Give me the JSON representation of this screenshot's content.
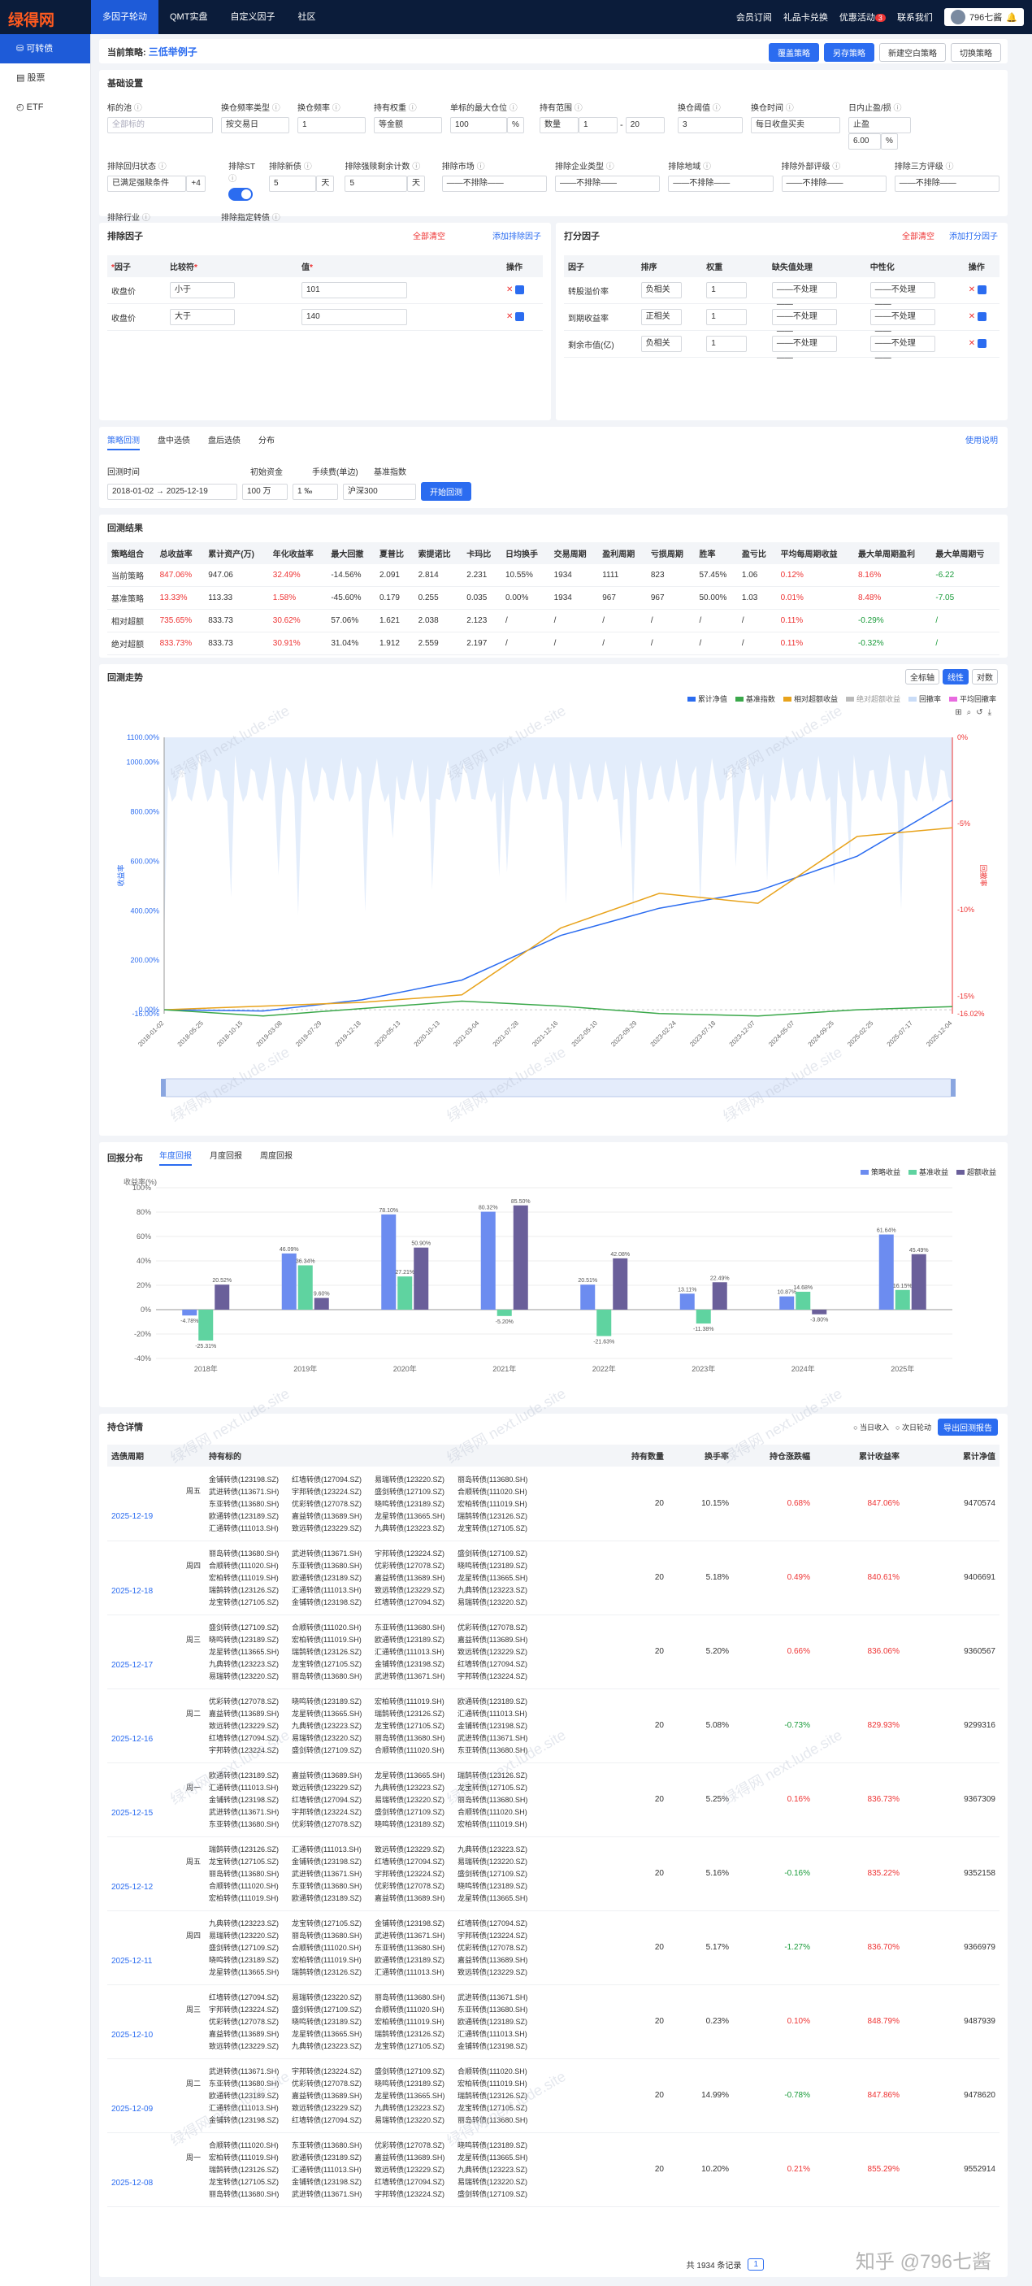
{
  "app": {
    "logo": "绿得网",
    "nav": [
      "多因子轮动",
      "QMT实盘",
      "自定义因子",
      "社区"
    ],
    "right": [
      "会员订阅",
      "礼品卡兑换",
      "优惠活动",
      "联系我们"
    ],
    "badge_count": "3",
    "user": "796七酱"
  },
  "sidebar": [
    "可转债",
    "股票",
    "ETF"
  ],
  "strategy": {
    "label": "当前策略:",
    "name": "三低举例子",
    "buttons": [
      "覆盖策略",
      "另存策略",
      "新建空白策略",
      "切换策略"
    ]
  },
  "basic": {
    "title": "基础设置",
    "row1": [
      {
        "label": "标的池",
        "value": "全部标的",
        "ph": true
      },
      {
        "label": "换仓频率类型",
        "value": "按交易日"
      },
      {
        "label": "换仓频率",
        "value": "1"
      },
      {
        "label": "持有权重",
        "value": "等金额"
      },
      {
        "label": "单标的最大仓位",
        "value": "100",
        "unit": "%"
      },
      {
        "label": "持有范围",
        "value": "数量",
        "from": "1",
        "to": "20"
      },
      {
        "label": "换仓阈值",
        "value": "3"
      },
      {
        "label": "换仓时间",
        "value": "每日收盘买卖"
      },
      {
        "label": "日内止盈/损",
        "value": "止盈",
        "pct": "6.00",
        "unit": "%"
      }
    ],
    "row2": [
      {
        "label": "排除回归状态",
        "value": "已满足强赎条件",
        "extra": "+4"
      },
      {
        "label": "排除ST"
      },
      {
        "label": "排除新债",
        "value": "5",
        "unit": "天"
      },
      {
        "label": "排除强赎剩余计数",
        "value": "5",
        "unit": "天"
      },
      {
        "label": "排除市场",
        "value": "——不排除——"
      },
      {
        "label": "排除企业类型",
        "value": "——不排除——"
      },
      {
        "label": "排除地域",
        "value": "——不排除——"
      },
      {
        "label": "排除外部评级",
        "value": "——不排除——"
      },
      {
        "label": "排除三方评级",
        "value": "——不排除——"
      }
    ],
    "row3": [
      {
        "label": "排除行业",
        "value": "——不排除——"
      },
      {
        "label": "排除指定转债",
        "value": "——不排除——"
      }
    ]
  },
  "exclude": {
    "title": "排除因子",
    "clear": "全部清空",
    "add": "添加排除因子",
    "cols": [
      "因子",
      "比较符",
      "值",
      "操作"
    ],
    "rows": [
      {
        "factor": "收盘价",
        "op": "小于",
        "val": "101"
      },
      {
        "factor": "收盘价",
        "op": "大于",
        "val": "140"
      }
    ]
  },
  "score": {
    "title": "打分因子",
    "clear": "全部清空",
    "add": "添加打分因子",
    "cols": [
      "因子",
      "排序",
      "权重",
      "缺失值处理",
      "中性化",
      "操作"
    ],
    "rows": [
      {
        "factor": "转股溢价率",
        "sort": "负相关",
        "w": "1"
      },
      {
        "factor": "到期收益率",
        "sort": "正相关",
        "w": "1"
      },
      {
        "factor": "剩余市值(亿)",
        "sort": "负相关",
        "w": "1"
      }
    ],
    "nohandle": "——不处理——"
  },
  "backtest": {
    "tabs": [
      "策略回测",
      "盘中选债",
      "盘后选债",
      "分布"
    ],
    "help": "使用说明",
    "labels": [
      "回测时间",
      "初始资金",
      "手续费(单边)",
      "基准指数"
    ],
    "start": "2018-01-02",
    "end": "2025-12-19",
    "capital": "100",
    "capital_unit": "万",
    "fee": "1",
    "fee_unit": "‰",
    "index": "沪深300",
    "run": "开始回测"
  },
  "results": {
    "title": "回测结果",
    "cols": [
      "策略组合",
      "总收益率",
      "累计资产(万)",
      "年化收益率",
      "最大回撤",
      "夏普比",
      "索提诺比",
      "卡玛比",
      "日均换手",
      "交易周期",
      "盈利周期",
      "亏损周期",
      "胜率",
      "盈亏比",
      "平均每周期收益",
      "最大单周期盈利",
      "最大单周期亏"
    ],
    "rows": [
      [
        "当前策略",
        "847.06%",
        "947.06",
        "32.49%",
        "-14.56%",
        "2.091",
        "2.814",
        "2.231",
        "10.55%",
        "1934",
        "1111",
        "823",
        "57.45%",
        "1.06",
        "0.12%",
        "8.16%",
        "-6.22"
      ],
      [
        "基准策略",
        "13.33%",
        "113.33",
        "1.58%",
        "-45.60%",
        "0.179",
        "0.255",
        "0.035",
        "0.00%",
        "1934",
        "967",
        "967",
        "50.00%",
        "1.03",
        "0.01%",
        "8.48%",
        "-7.05"
      ],
      [
        "相对超额",
        "735.65%",
        "833.73",
        "30.62%",
        "57.06%",
        "1.621",
        "2.038",
        "2.123",
        "/",
        "/",
        "/",
        "/",
        "/",
        "/",
        "0.11%",
        "-0.29%",
        "/"
      ],
      [
        "绝对超额",
        "833.73%",
        "833.73",
        "30.91%",
        "31.04%",
        "1.912",
        "2.559",
        "2.197",
        "/",
        "/",
        "/",
        "/",
        "/",
        "/",
        "0.11%",
        "-0.32%",
        "/"
      ]
    ]
  },
  "trend": {
    "title": "回测走势",
    "toggles": [
      "全标轴",
      "线性",
      "对数"
    ],
    "legend": [
      "累计净值",
      "基准指数",
      "相对超额收益",
      "绝对超额收益",
      "回撤率",
      "平均回撤率"
    ],
    "ylabel_left": "收益率",
    "ylabel_right": "回撤率",
    "yticks_left": [
      "1100.00%",
      "1000.00%",
      "800.00%",
      "600.00%",
      "400.00%",
      "200.00%",
      "0.00%",
      "-16.00%"
    ],
    "yticks_right": [
      "0%",
      "-5%",
      "-10%",
      "-15%",
      "-16.02%"
    ],
    "xticks": [
      "2018-01-02",
      "2018-05-25",
      "2018-10-15",
      "2019-03-08",
      "2019-07-29",
      "2019-12-18",
      "2020-05-13",
      "2020-10-13",
      "2021-03-04",
      "2021-07-28",
      "2021-12-16",
      "2022-05-10",
      "2022-09-29",
      "2023-02-24",
      "2023-07-18",
      "2023-12-07",
      "2024-05-07",
      "2024-09-25",
      "2025-02-25",
      "2025-07-17",
      "2025-12-04"
    ]
  },
  "chart_data": [
    {
      "type": "line",
      "title": "回测走势",
      "x": [
        "2018-01-02",
        "2019-01-02",
        "2020-01-02",
        "2021-01-04",
        "2022-01-04",
        "2023-01-03",
        "2024-01-02",
        "2025-01-02",
        "2025-12-19"
      ],
      "series": [
        {
          "name": "累计净值",
          "values": [
            0,
            -5,
            40,
            120,
            300,
            410,
            480,
            620,
            847
          ]
        },
        {
          "name": "相对超额收益",
          "values": [
            0,
            15,
            30,
            60,
            330,
            470,
            430,
            700,
            735
          ]
        },
        {
          "name": "基准指数",
          "values": [
            0,
            -25,
            5,
            35,
            15,
            -15,
            -25,
            0,
            13
          ]
        }
      ],
      "ylabel": "收益率",
      "ylim": [
        -16,
        1100
      ]
    },
    {
      "type": "bar",
      "title": "回报分布",
      "categories": [
        "2018年",
        "2019年",
        "2020年",
        "2021年",
        "2022年",
        "2023年",
        "2024年",
        "2025年"
      ],
      "series": [
        {
          "name": "策略收益",
          "values": [
            -4.78,
            46.09,
            78.1,
            80.32,
            20.51,
            13.11,
            10.87,
            61.64
          ]
        },
        {
          "name": "基准收益",
          "values": [
            -25.31,
            36.34,
            27.21,
            -5.2,
            -21.63,
            -11.38,
            14.68,
            16.15
          ]
        },
        {
          "name": "超额收益",
          "values": [
            20.52,
            9.6,
            50.9,
            85.5,
            42.08,
            22.49,
            -3.8,
            45.49
          ]
        }
      ],
      "ylabel": "收益率(%)",
      "ylim": [
        -40,
        100
      ],
      "yticks": [
        "100%",
        "80%",
        "60%",
        "40%",
        "20%",
        "0%",
        "-20%",
        "-40%"
      ]
    }
  ],
  "dist": {
    "title": "回报分布",
    "tabs": [
      "年度回报",
      "月度回报",
      "周度回报"
    ]
  },
  "holdings": {
    "title": "持仓详情",
    "options": [
      "当日收入",
      "次日轮动"
    ],
    "export": "导出回测报告",
    "cols": [
      "选债周期",
      "持有标的",
      "持有数量",
      "换手率",
      "持仓涨跌幅",
      "累计收益率",
      "累计净值"
    ],
    "rows": [
      {
        "date": "2025-12-19",
        "wd": "周五",
        "n": "20",
        "turn": "10.15%",
        "chg": "0.68%",
        "cum": "847.06%",
        "nav": "9470574"
      },
      {
        "date": "2025-12-18",
        "wd": "周四",
        "n": "20",
        "turn": "5.18%",
        "chg": "0.49%",
        "cum": "840.61%",
        "nav": "9406691"
      },
      {
        "date": "2025-12-17",
        "wd": "周三",
        "n": "20",
        "turn": "5.20%",
        "chg": "0.66%",
        "cum": "836.06%",
        "nav": "9360567"
      },
      {
        "date": "2025-12-16",
        "wd": "周二",
        "n": "20",
        "turn": "5.08%",
        "chg": "-0.73%",
        "cum": "829.93%",
        "nav": "9299316"
      },
      {
        "date": "2025-12-15",
        "wd": "周一",
        "n": "20",
        "turn": "5.25%",
        "chg": "0.16%",
        "cum": "836.73%",
        "nav": "9367309"
      },
      {
        "date": "2025-12-12",
        "wd": "周五",
        "n": "20",
        "turn": "5.16%",
        "chg": "-0.16%",
        "cum": "835.22%",
        "nav": "9352158"
      },
      {
        "date": "2025-12-11",
        "wd": "周四",
        "n": "20",
        "turn": "5.17%",
        "chg": "-1.27%",
        "cum": "836.70%",
        "nav": "9366979"
      },
      {
        "date": "2025-12-10",
        "wd": "周三",
        "n": "20",
        "turn": "0.23%",
        "chg": "0.10%",
        "cum": "848.79%",
        "nav": "9487939"
      },
      {
        "date": "2025-12-09",
        "wd": "周二",
        "n": "20",
        "turn": "14.99%",
        "chg": "-0.78%",
        "cum": "847.86%",
        "nav": "9478620"
      },
      {
        "date": "2025-12-08",
        "wd": "周一",
        "n": "20",
        "turn": "10.20%",
        "chg": "0.21%",
        "cum": "855.29%",
        "nav": "9552914"
      }
    ],
    "bonds": [
      "金铺转债(123198.SZ)",
      "红墙转债(127094.SZ)",
      "易瑞转债(123220.SZ)",
      "丽岛转债(113680.SH)",
      "武进转债(113671.SH)",
      "宇邦转债(123224.SZ)",
      "盛剑转债(127109.SZ)",
      "合顺转债(111020.SH)",
      "东亚转债(113680.SH)",
      "优彩转债(127078.SZ)",
      "晓鸣转债(123189.SZ)",
      "宏柏转债(111019.SH)",
      "欧通转债(123189.SZ)",
      "嘉益转债(113689.SH)",
      "龙星转债(113665.SH)",
      "瑞鹄转债(123126.SZ)",
      "汇通转债(111013.SH)",
      "致远转债(123229.SZ)",
      "九典转债(123223.SZ)",
      "龙宝转债(127105.SZ)"
    ],
    "footer": {
      "total": "共 1934 条记录",
      "page": "1"
    }
  },
  "watermark": "绿得网 next.lude.site",
  "zhihu": "知乎 @796七酱"
}
